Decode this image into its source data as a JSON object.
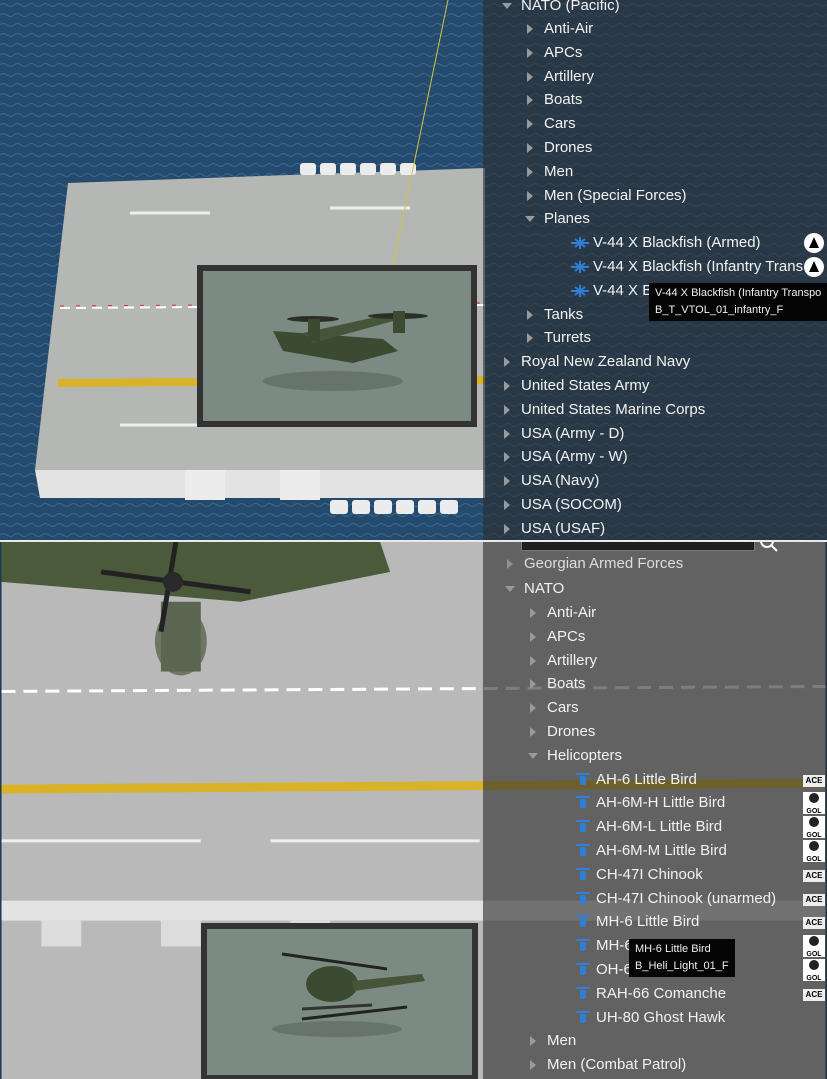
{
  "top_panel": {
    "root": "NATO (Pacific)",
    "categories_before": [
      "Anti-Air",
      "APCs",
      "Artillery",
      "Boats",
      "Cars",
      "Drones",
      "Men",
      "Men (Special Forces)"
    ],
    "open_category": "Planes",
    "units": [
      {
        "label": "V-44 X Blackfish (Armed)",
        "addon": "a3-icon"
      },
      {
        "label": "V-44 X Blackfish (Infantry Trans",
        "addon": "a3-icon"
      },
      {
        "label": "V-44 X Bl",
        "addon": ""
      }
    ],
    "categories_after": [
      "Tanks",
      "Turrets"
    ],
    "factions": [
      "Royal New Zealand Navy",
      "United States Army",
      "United States Marine Corps",
      "USA (Army - D)",
      "USA (Army - W)",
      "USA (Navy)",
      "USA (SOCOM)",
      "USA (USAF)"
    ],
    "tooltip": {
      "name": "V-44 X Blackfish (Infantry Transpo",
      "classname": "B_T_VTOL_01_infantry_F"
    }
  },
  "bottom_panel": {
    "faction_partial": "Georgian Armed Forces",
    "root": "NATO",
    "categories_before": [
      "Anti-Air",
      "APCs",
      "Artillery",
      "Boats",
      "Cars",
      "Drones"
    ],
    "open_category": "Helicopters",
    "units": [
      {
        "label": "AH-6 Little Bird",
        "addon": "ace-icon"
      },
      {
        "label": "AH-6M-H Little Bird",
        "addon": "gol-icon"
      },
      {
        "label": "AH-6M-L Little Bird",
        "addon": "gol-icon"
      },
      {
        "label": "AH-6M-M Little Bird",
        "addon": "gol-icon"
      },
      {
        "label": "CH-47I Chinook",
        "addon": "ace-icon"
      },
      {
        "label": "CH-47I Chinook (unarmed)",
        "addon": "ace-icon"
      },
      {
        "label": "MH-6 Little Bird",
        "addon": "ace-icon"
      },
      {
        "label": "MH-6",
        "addon": "gol-icon"
      },
      {
        "label": "OH-6",
        "addon": "gol-icon"
      },
      {
        "label": "RAH-66 Comanche",
        "addon": "ace-icon"
      },
      {
        "label": "UH-80 Ghost Hawk",
        "addon": ""
      }
    ],
    "categories_after": [
      "Men",
      "Men (Combat Patrol)"
    ],
    "tooltip": {
      "name": "MH-6 Little Bird",
      "classname": "B_Heli_Light_01_F"
    }
  },
  "addon_labels": {
    "ace": "ACE",
    "gol": "GOL"
  },
  "colors": {
    "panel": "#2d2d2d",
    "text": "#f2f2f2",
    "unit_icon": "#2f7fd8",
    "tooltip_bg": "#050505"
  }
}
